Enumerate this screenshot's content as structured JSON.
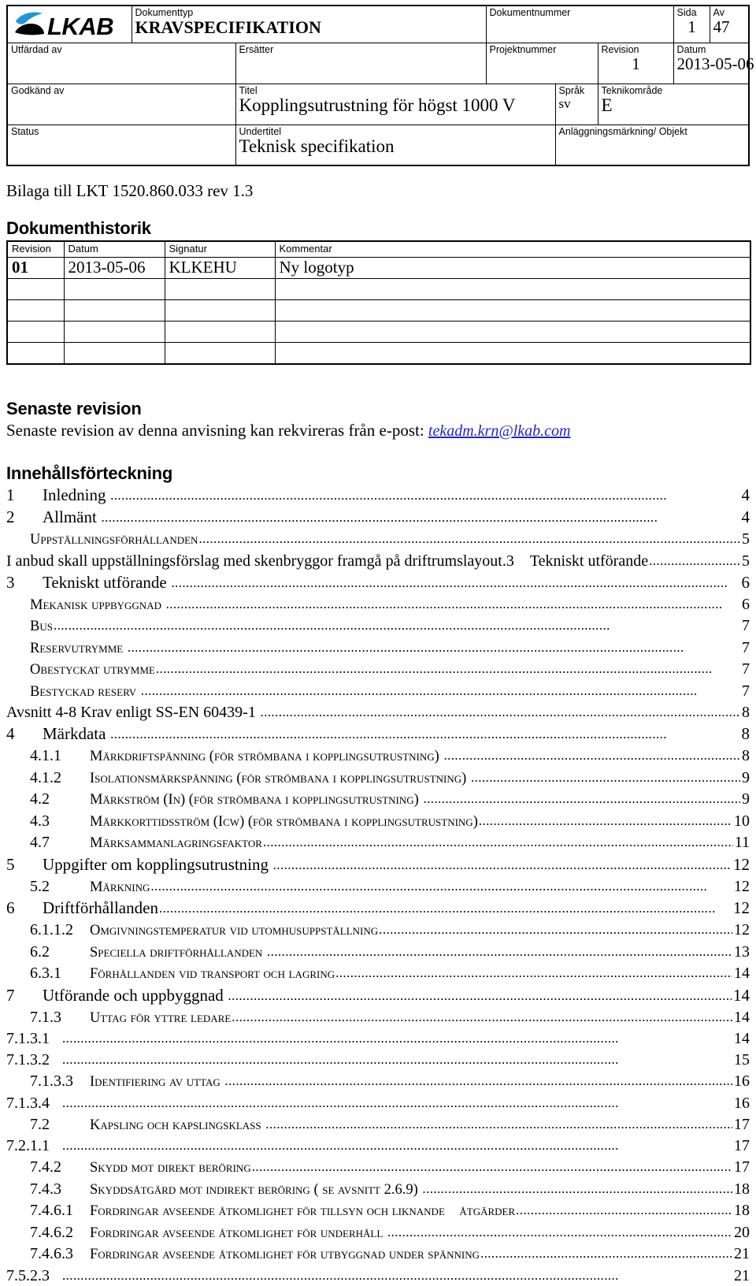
{
  "header": {
    "logo_text": "LKAB",
    "logo_colors": {
      "swoosh": "#2196d8",
      "mound": "#000000"
    },
    "fields": {
      "dokumenttyp_label": "Dokumenttyp",
      "dokumenttyp_value": "KRAVSPECIFIKATION",
      "dokumentnummer_label": "Dokumentnummer",
      "dokumentnummer_value": "",
      "sida_label": "Sida",
      "sida_value": "1",
      "av_label": "Av",
      "av_value": "47",
      "utfardad_label": "Utfärdad av",
      "utfardad_value": "",
      "ersatter_label": "Ersätter",
      "ersatter_value": "",
      "projektnummer_label": "Projektnummer",
      "projektnummer_value": "",
      "revision_label": "Revision",
      "revision_value": "1",
      "datum_label": "Datum",
      "datum_value": "2013-05-06",
      "godkand_label": "Godkänd av",
      "godkand_value": "",
      "titel_label": "Titel",
      "titel_value": "Kopplingsutrustning för högst 1000 V",
      "sprak_label": "Språk",
      "sprak_value": "sv",
      "teknikomrade_label": "Teknikområde",
      "teknikomrade_value": "E",
      "status_label": "Status",
      "status_value": "",
      "undertitel_label": "Undertitel",
      "undertitel_value": "Teknisk specifikation",
      "anlaggning_label": "Anläggningsmärkning/ Objekt",
      "anlaggning_value": ""
    }
  },
  "bilaga": "Bilaga till LKT 1520.860.033 rev 1.3",
  "history": {
    "heading": "Dokumenthistorik",
    "columns": [
      "Revision",
      "Datum",
      "Signatur",
      "Kommentar"
    ],
    "rows": [
      {
        "revision": "01",
        "datum": "2013-05-06",
        "signatur": "KLKEHU",
        "kommentar": "Ny logotyp"
      },
      {
        "revision": "",
        "datum": "",
        "signatur": "",
        "kommentar": ""
      },
      {
        "revision": "",
        "datum": "",
        "signatur": "",
        "kommentar": ""
      },
      {
        "revision": "",
        "datum": "",
        "signatur": "",
        "kommentar": ""
      },
      {
        "revision": "",
        "datum": "",
        "signatur": "",
        "kommentar": ""
      }
    ]
  },
  "senaste": {
    "heading": "Senaste revision",
    "text_before": "Senaste revision av denna anvisning kan rekvireras från e-post: ",
    "email": "tekadm.krn@lkab.com",
    "email_color": "#2222cc"
  },
  "toc": {
    "heading": "Innehållsförteckning",
    "entries": [
      {
        "num": "1",
        "text": "Inledning",
        "page": "4",
        "style": "lvl1"
      },
      {
        "num": "2",
        "text": "Allmänt",
        "page": "4",
        "style": "lvl1"
      },
      {
        "num": "",
        "text": "Uppställningsförhållanden",
        "page": "5",
        "style": "lvl2"
      },
      {
        "num": "",
        "text": "I anbud skall uppställningsförslag med skenbryggor framgå på driftrumslayout.3 Tekniskt utförande",
        "page": "5",
        "style": "lvl0"
      },
      {
        "num": "3",
        "text": "Tekniskt utförande",
        "page": "6",
        "style": "lvl1"
      },
      {
        "num": "",
        "text": "Mekanisk uppbyggnad",
        "page": "6",
        "style": "lvl2"
      },
      {
        "num": "",
        "text": "Bus",
        "page": "7",
        "style": "lvl2"
      },
      {
        "num": "",
        "text": "Reservutrymme",
        "page": "7",
        "style": "lvl2"
      },
      {
        "num": "",
        "text": "Obestyckat utrymme",
        "page": "7",
        "style": "lvl2"
      },
      {
        "num": "",
        "text": "Bestyckad reserv",
        "page": "7",
        "style": "lvl2"
      },
      {
        "num": "",
        "text": "Avsnitt 4-8  Krav enligt SS-EN 60439-1",
        "page": "8",
        "style": "lvl0"
      },
      {
        "num": "4",
        "text": "Märkdata",
        "page": "8",
        "style": "lvl1"
      },
      {
        "num": "4.1.1",
        "text": "Märkdriftspänning (för strömbana i kopplingsutrustning)",
        "page": "8",
        "style": "lvl2n"
      },
      {
        "num": "4.1.2",
        "text": "Isolationsmärkspänning (för strömbana i kopplingsutrustning)",
        "page": "9",
        "style": "lvl2n"
      },
      {
        "num": "4.2",
        "text": "Märkström (In) (för strömbana i kopplingsutrustning)",
        "page": "9",
        "style": "lvl2n"
      },
      {
        "num": "4.3",
        "text": "Märkkorttidsström (Icw) (för strömbana i kopplingsutrustning)",
        "page": "10",
        "style": "lvl2n"
      },
      {
        "num": "4.7",
        "text": "Märksammanlagringsfaktor",
        "page": "11",
        "style": "lvl2n"
      },
      {
        "num": "5",
        "text": "Uppgifter om kopplingsutrustning",
        "page": "12",
        "style": "lvl1"
      },
      {
        "num": "5.2",
        "text": "Märkning",
        "page": "12",
        "style": "lvl2n"
      },
      {
        "num": "6",
        "text": "Driftförhållanden",
        "page": "12",
        "style": "lvl1"
      },
      {
        "num": "6.1.1.2",
        "text": "Omgivningstemperatur vid utomhusuppställning",
        "page": "12",
        "style": "lvl2n"
      },
      {
        "num": "6.2",
        "text": "Speciella driftförhållanden",
        "page": "13",
        "style": "lvl2n"
      },
      {
        "num": "6.3.1",
        "text": "Förhållanden vid transport och lagring",
        "page": "14",
        "style": "lvl2n"
      },
      {
        "num": "7",
        "text": "Utförande och uppbyggnad",
        "page": "14",
        "style": "lvl1"
      },
      {
        "num": "7.1.3",
        "text": "Uttag för yttre ledare",
        "page": "14",
        "style": "lvl2n"
      },
      {
        "num": "7.1.3.1",
        "text": "",
        "page": "14",
        "style": "lvlplain"
      },
      {
        "num": "7.1.3.2",
        "text": "",
        "page": "15",
        "style": "lvlplain"
      },
      {
        "num": "7.1.3.3",
        "text": "Identifiering av uttag",
        "page": "16",
        "style": "lvl2n"
      },
      {
        "num": "7.1.3.4",
        "text": "",
        "page": "16",
        "style": "lvlplain"
      },
      {
        "num": "7.2",
        "text": "Kapsling och kapslingsklass",
        "page": "17",
        "style": "lvl2n"
      },
      {
        "num": "7.2.1.1",
        "text": "",
        "page": "17",
        "style": "lvlplain"
      },
      {
        "num": "7.4.2",
        "text": "Skydd mot direkt beröring",
        "page": "17",
        "style": "lvl2n"
      },
      {
        "num": "7.4.3",
        "text": "Skyddsåtgärd mot indirekt beröring ( se avsnitt 2.6.9)",
        "page": "18",
        "style": "lvl2n"
      },
      {
        "num": "7.4.6.1",
        "text": "Fordringar avseende åtkomlighet för tillsyn och liknande åtgärder",
        "page": "18",
        "style": "lvl2n"
      },
      {
        "num": "7.4.6.2",
        "text": "Fordringar avseende åtkomlighet för underhåll",
        "page": "20",
        "style": "lvl2n"
      },
      {
        "num": "7.4.6.3",
        "text": "Fordringar avseende åtkomlighet för utbyggnad under spänning",
        "page": "21",
        "style": "lvl2n"
      },
      {
        "num": "7.5.2.3",
        "text": "",
        "page": "21",
        "style": "lvlplain"
      }
    ]
  }
}
